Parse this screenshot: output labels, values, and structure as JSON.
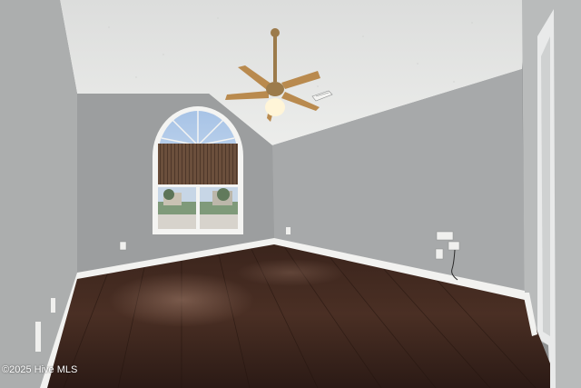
{
  "photo": {
    "watermark": "©2025 Hive MLS"
  },
  "palette": {
    "ceiling": "#e6e7e5",
    "wall_left": "#a9abab",
    "wall_back": "#9b9d9e",
    "wall_right": "#a5a7a8",
    "door_frame": "#e9eaea",
    "baseboard": "#f2f2f0",
    "floor_dark": "#2b1a15",
    "floor_mid": "#5a3a2e",
    "sky": "#bcd2ec",
    "blind": "#6b4f3c",
    "fan_blade": "#b98a4e",
    "fan_metal": "#9c7b4b",
    "fan_light": "#fff5d8"
  }
}
